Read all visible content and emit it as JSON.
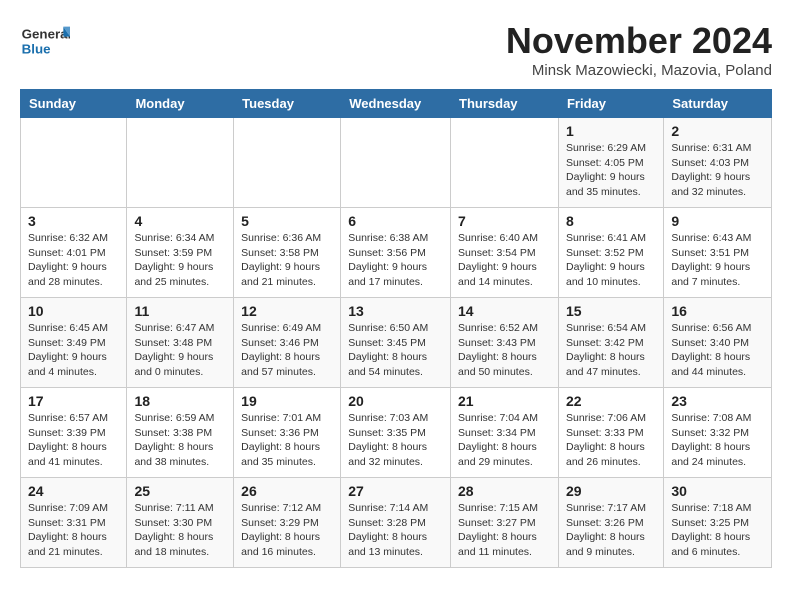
{
  "app": {
    "logo_general": "General",
    "logo_blue": "Blue"
  },
  "header": {
    "month": "November 2024",
    "location": "Minsk Mazowiecki, Mazovia, Poland"
  },
  "calendar": {
    "weekdays": [
      "Sunday",
      "Monday",
      "Tuesday",
      "Wednesday",
      "Thursday",
      "Friday",
      "Saturday"
    ],
    "weeks": [
      [
        {
          "day": "",
          "info": ""
        },
        {
          "day": "",
          "info": ""
        },
        {
          "day": "",
          "info": ""
        },
        {
          "day": "",
          "info": ""
        },
        {
          "day": "",
          "info": ""
        },
        {
          "day": "1",
          "info": "Sunrise: 6:29 AM\nSunset: 4:05 PM\nDaylight: 9 hours\nand 35 minutes."
        },
        {
          "day": "2",
          "info": "Sunrise: 6:31 AM\nSunset: 4:03 PM\nDaylight: 9 hours\nand 32 minutes."
        }
      ],
      [
        {
          "day": "3",
          "info": "Sunrise: 6:32 AM\nSunset: 4:01 PM\nDaylight: 9 hours\nand 28 minutes."
        },
        {
          "day": "4",
          "info": "Sunrise: 6:34 AM\nSunset: 3:59 PM\nDaylight: 9 hours\nand 25 minutes."
        },
        {
          "day": "5",
          "info": "Sunrise: 6:36 AM\nSunset: 3:58 PM\nDaylight: 9 hours\nand 21 minutes."
        },
        {
          "day": "6",
          "info": "Sunrise: 6:38 AM\nSunset: 3:56 PM\nDaylight: 9 hours\nand 17 minutes."
        },
        {
          "day": "7",
          "info": "Sunrise: 6:40 AM\nSunset: 3:54 PM\nDaylight: 9 hours\nand 14 minutes."
        },
        {
          "day": "8",
          "info": "Sunrise: 6:41 AM\nSunset: 3:52 PM\nDaylight: 9 hours\nand 10 minutes."
        },
        {
          "day": "9",
          "info": "Sunrise: 6:43 AM\nSunset: 3:51 PM\nDaylight: 9 hours\nand 7 minutes."
        }
      ],
      [
        {
          "day": "10",
          "info": "Sunrise: 6:45 AM\nSunset: 3:49 PM\nDaylight: 9 hours\nand 4 minutes."
        },
        {
          "day": "11",
          "info": "Sunrise: 6:47 AM\nSunset: 3:48 PM\nDaylight: 9 hours\nand 0 minutes."
        },
        {
          "day": "12",
          "info": "Sunrise: 6:49 AM\nSunset: 3:46 PM\nDaylight: 8 hours\nand 57 minutes."
        },
        {
          "day": "13",
          "info": "Sunrise: 6:50 AM\nSunset: 3:45 PM\nDaylight: 8 hours\nand 54 minutes."
        },
        {
          "day": "14",
          "info": "Sunrise: 6:52 AM\nSunset: 3:43 PM\nDaylight: 8 hours\nand 50 minutes."
        },
        {
          "day": "15",
          "info": "Sunrise: 6:54 AM\nSunset: 3:42 PM\nDaylight: 8 hours\nand 47 minutes."
        },
        {
          "day": "16",
          "info": "Sunrise: 6:56 AM\nSunset: 3:40 PM\nDaylight: 8 hours\nand 44 minutes."
        }
      ],
      [
        {
          "day": "17",
          "info": "Sunrise: 6:57 AM\nSunset: 3:39 PM\nDaylight: 8 hours\nand 41 minutes."
        },
        {
          "day": "18",
          "info": "Sunrise: 6:59 AM\nSunset: 3:38 PM\nDaylight: 8 hours\nand 38 minutes."
        },
        {
          "day": "19",
          "info": "Sunrise: 7:01 AM\nSunset: 3:36 PM\nDaylight: 8 hours\nand 35 minutes."
        },
        {
          "day": "20",
          "info": "Sunrise: 7:03 AM\nSunset: 3:35 PM\nDaylight: 8 hours\nand 32 minutes."
        },
        {
          "day": "21",
          "info": "Sunrise: 7:04 AM\nSunset: 3:34 PM\nDaylight: 8 hours\nand 29 minutes."
        },
        {
          "day": "22",
          "info": "Sunrise: 7:06 AM\nSunset: 3:33 PM\nDaylight: 8 hours\nand 26 minutes."
        },
        {
          "day": "23",
          "info": "Sunrise: 7:08 AM\nSunset: 3:32 PM\nDaylight: 8 hours\nand 24 minutes."
        }
      ],
      [
        {
          "day": "24",
          "info": "Sunrise: 7:09 AM\nSunset: 3:31 PM\nDaylight: 8 hours\nand 21 minutes."
        },
        {
          "day": "25",
          "info": "Sunrise: 7:11 AM\nSunset: 3:30 PM\nDaylight: 8 hours\nand 18 minutes."
        },
        {
          "day": "26",
          "info": "Sunrise: 7:12 AM\nSunset: 3:29 PM\nDaylight: 8 hours\nand 16 minutes."
        },
        {
          "day": "27",
          "info": "Sunrise: 7:14 AM\nSunset: 3:28 PM\nDaylight: 8 hours\nand 13 minutes."
        },
        {
          "day": "28",
          "info": "Sunrise: 7:15 AM\nSunset: 3:27 PM\nDaylight: 8 hours\nand 11 minutes."
        },
        {
          "day": "29",
          "info": "Sunrise: 7:17 AM\nSunset: 3:26 PM\nDaylight: 8 hours\nand 9 minutes."
        },
        {
          "day": "30",
          "info": "Sunrise: 7:18 AM\nSunset: 3:25 PM\nDaylight: 8 hours\nand 6 minutes."
        }
      ]
    ]
  }
}
